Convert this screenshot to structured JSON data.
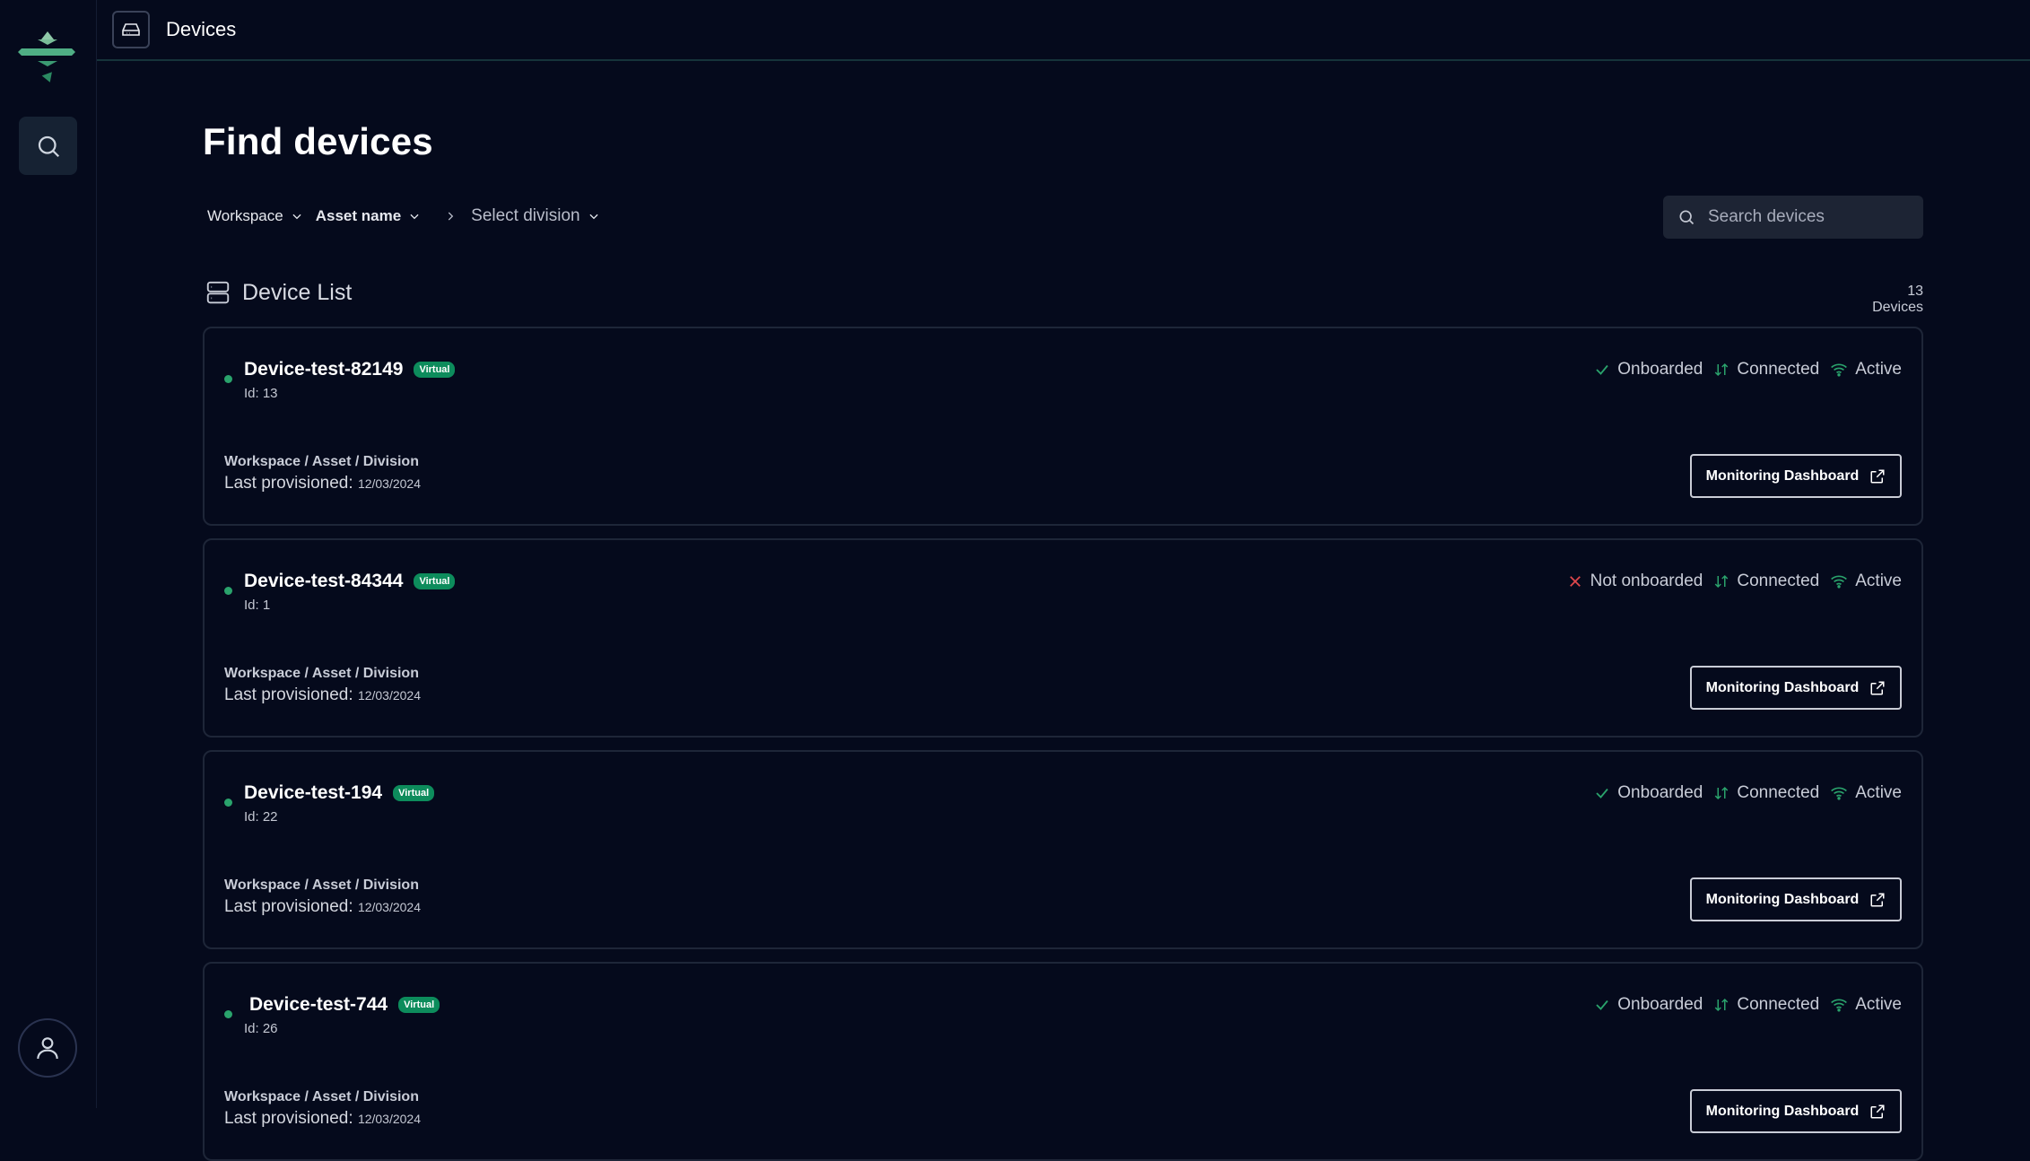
{
  "topbar": {
    "title": "Devices",
    "icon": "hard-drive-icon"
  },
  "sidebar": {
    "items": [
      {
        "name": "logo"
      },
      {
        "name": "search",
        "icon": "search-icon"
      },
      {
        "name": "user",
        "icon": "user-icon"
      }
    ]
  },
  "page": {
    "title": "Find devices"
  },
  "filters": {
    "workspace": "Workspace",
    "asset": "Asset name",
    "division": "Select division"
  },
  "search": {
    "placeholder": "Search devices"
  },
  "list": {
    "title": "Device List",
    "count": "13 Devices"
  },
  "path_label": "Workspace / Asset / Division",
  "provisioned_label": "Last provisioned:",
  "button_label": "Monitoring Dashboard",
  "devices": [
    {
      "name": "Device-test-82149",
      "badge": "Virtual",
      "id": "Id: 13",
      "date": "12/03/2024",
      "onboard": "Onboarded",
      "onboarded": true,
      "connection": "Connected",
      "activity": "Active"
    },
    {
      "name": "Device-test-84344",
      "badge": "Virtual",
      "id": "Id: 1",
      "date": "12/03/2024",
      "onboard": "Not onboarded",
      "onboarded": false,
      "connection": "Connected",
      "activity": "Active"
    },
    {
      "name": "Device-test-194",
      "badge": "Virtual",
      "id": "Id: 22",
      "date": "12/03/2024",
      "onboard": "Onboarded",
      "onboarded": true,
      "connection": "Connected",
      "activity": "Active"
    },
    {
      "name": "Device-test-744",
      "badge": "Virtual",
      "id": "Id: 26",
      "date": "12/03/2024",
      "onboard": "Onboarded",
      "onboarded": true,
      "connection": "Connected",
      "activity": "Active"
    }
  ],
  "colors": {
    "background": "#050a1c",
    "accent": "#2aa36c",
    "badge": "#0d8c5c",
    "error": "#e0474c"
  }
}
